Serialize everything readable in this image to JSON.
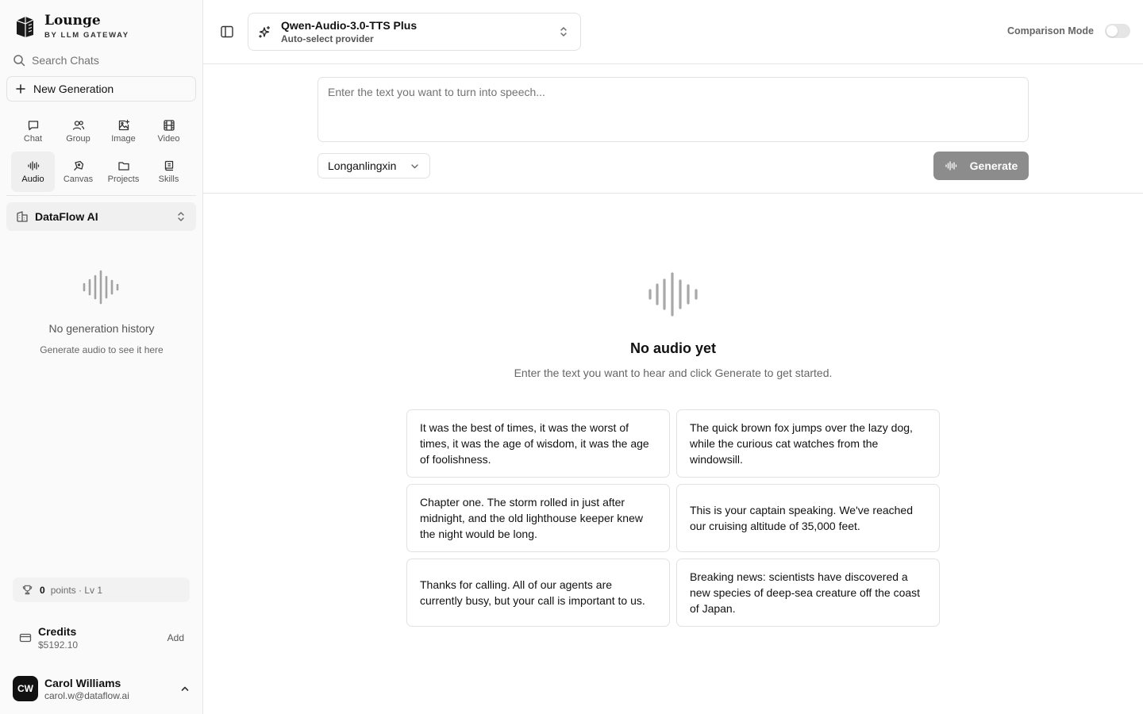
{
  "brand": {
    "name": "Lounge",
    "subtitle": "BY LLM GATEWAY"
  },
  "sidebar": {
    "search_placeholder": "Search Chats",
    "new_generation": "New Generation",
    "modes": [
      {
        "label": "Chat",
        "icon": "chat-icon"
      },
      {
        "label": "Group",
        "icon": "group-icon"
      },
      {
        "label": "Image",
        "icon": "image-icon"
      },
      {
        "label": "Video",
        "icon": "video-icon"
      },
      {
        "label": "Audio",
        "icon": "audio-icon",
        "active": true
      },
      {
        "label": "Canvas",
        "icon": "canvas-icon"
      },
      {
        "label": "Projects",
        "icon": "folder-icon"
      },
      {
        "label": "Skills",
        "icon": "skills-icon"
      }
    ],
    "workspace": "DataFlow AI",
    "history_empty_title": "No generation history",
    "history_empty_subtitle": "Generate audio to see it here",
    "points": {
      "value": "0",
      "level": "points · Lv 1"
    },
    "credits": {
      "label": "Credits",
      "amount": "$5192.10",
      "add": "Add"
    },
    "user": {
      "initials": "CW",
      "name": "Carol Williams",
      "email": "carol.w@dataflow.ai"
    }
  },
  "header": {
    "model_name": "Qwen-Audio-3.0-TTS Plus",
    "provider": "Auto-select provider",
    "comparison_mode": "Comparison Mode",
    "comparison_enabled": false
  },
  "composer": {
    "placeholder": "Enter the text you want to turn into speech...",
    "voice": "Longanlingxin",
    "generate": "Generate"
  },
  "empty_state": {
    "title": "No audio yet",
    "subtitle": "Enter the text you want to hear and click Generate to get started."
  },
  "samples": [
    "It was the best of times, it was the worst of times, it was the age of wisdom, it was the age of foolishness.",
    "The quick brown fox jumps over the lazy dog, while the curious cat watches from the windowsill.",
    "Chapter one. The storm rolled in just after midnight, and the old lighthouse keeper knew the night would be long.",
    "This is your captain speaking. We've reached our cruising altitude of 35,000 feet.",
    "Thanks for calling. All of our agents are currently busy, but your call is important to us.",
    "Breaking news: scientists have discovered a new species of deep-sea creature off the coast of Japan."
  ],
  "colors": {
    "sidebar_bg": "#fafafa",
    "border": "#e5e5e5",
    "button_disabled": "#8c8c8c",
    "text_primary": "#0a0a0a"
  }
}
